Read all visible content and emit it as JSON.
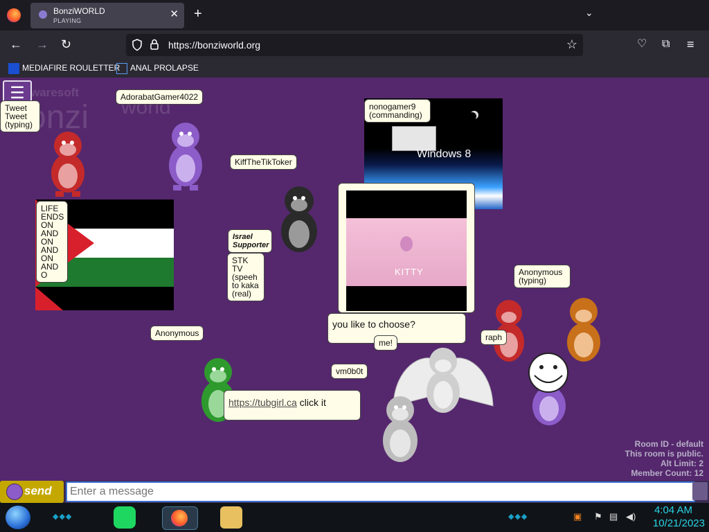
{
  "browser": {
    "tab_title": "BonziWORLD",
    "tab_subtitle": "PLAYING",
    "close_glyph": "✕",
    "new_tab_glyph": "+",
    "tab_list_glyph": "⌄",
    "url": "https://bonziworld.org",
    "nav": {
      "back": "←",
      "forward": "→",
      "reload": "↻"
    },
    "toolbar_right": {
      "pocket": "♡",
      "extensions": "⧉",
      "menu": "≡"
    },
    "bookmarks": [
      "MEDIAFIRE ROULETTER",
      "ANAL PROLAPSE"
    ]
  },
  "page": {
    "watermark_small": "waresoft",
    "watermark_big_left": "onzi",
    "watermark_big_right": "world",
    "menu_glyph": "☰",
    "bubbles": [
      {
        "id": "tweet",
        "text": "Tweet Tweet (typing)"
      },
      {
        "id": "adorabat",
        "text": "AdorabatGamer4022"
      },
      {
        "id": "kiff",
        "text": "KiffTheTikToker"
      },
      {
        "id": "nonogamer",
        "text": "nonogamer9 (commanding)"
      },
      {
        "id": "life",
        "text": "LIFE ENDS ON AND ON AND ON AND O"
      },
      {
        "id": "israel",
        "text": "Israel Supporter"
      },
      {
        "id": "stk",
        "text": "STK TV (speeh to kaka (real)"
      },
      {
        "id": "anon_typing",
        "text": "Anonymous (typing)"
      },
      {
        "id": "anon",
        "text": "Anonymous"
      },
      {
        "id": "raph",
        "text": "raph"
      },
      {
        "id": "vm0b0t",
        "text": "vm0b0t"
      },
      {
        "id": "choose",
        "text": "you like to choose?"
      },
      {
        "id": "me",
        "text": "me!"
      }
    ],
    "link_bubble": {
      "link": "https://tubgirl.ca",
      "rest": " click it"
    },
    "windows8_label": "Windows 8",
    "kitty_label": "KITTY",
    "stats": [
      "Room ID - default",
      "This room is public.",
      "Alt Limit: 2",
      "Member Count: 12"
    ]
  },
  "chat": {
    "send_label": "send",
    "placeholder": "Enter a message"
  },
  "taskbar": {
    "time": "4:04 AM",
    "date": "10/21/2023"
  },
  "colors": {
    "page_bg": "#55286d",
    "send_bg": "#c4a800",
    "clock": "#2ad4e6"
  }
}
